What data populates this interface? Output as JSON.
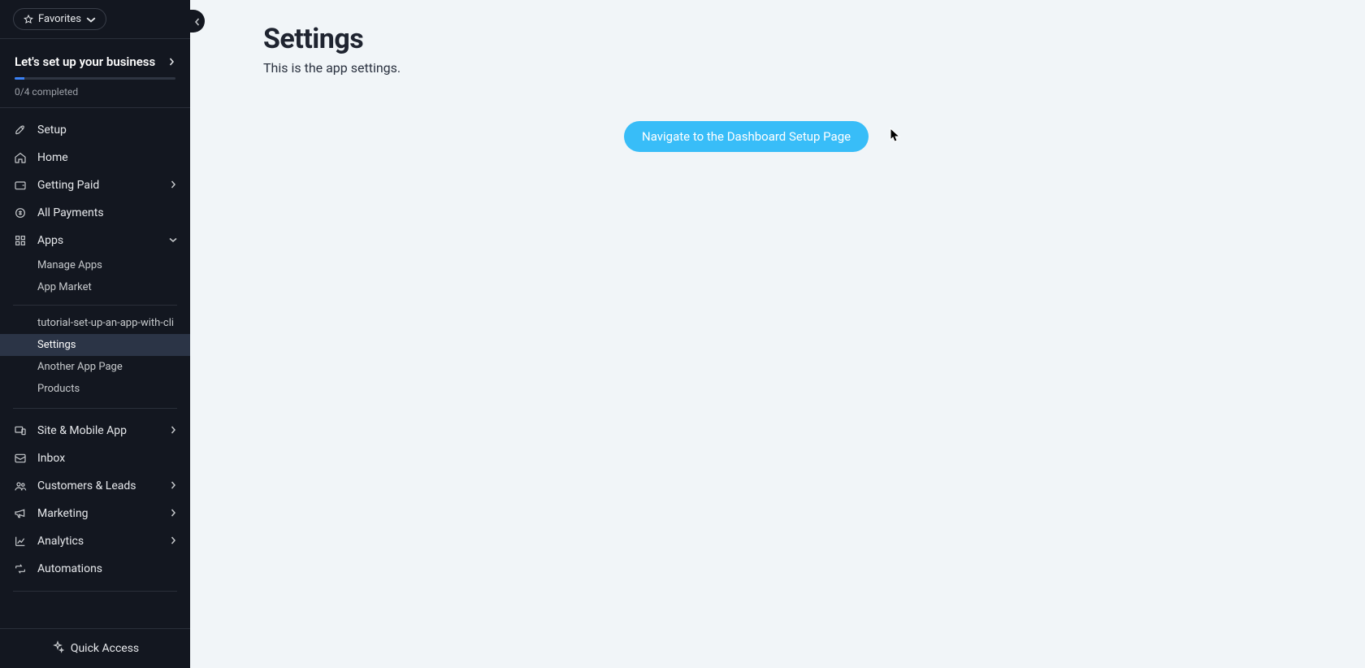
{
  "favorites": {
    "label": "Favorites"
  },
  "setup_block": {
    "title": "Let's set up your business",
    "progress_label": "0/4 completed"
  },
  "nav": {
    "setup": "Setup",
    "home": "Home",
    "getting_paid": "Getting Paid",
    "all_payments": "All Payments",
    "apps": "Apps",
    "apps_sub": {
      "manage_apps": "Manage Apps",
      "app_market": "App Market",
      "tutorial": "tutorial-set-up-an-app-with-cli",
      "settings": "Settings",
      "another_app_page": "Another App Page",
      "products": "Products"
    },
    "site_mobile": "Site & Mobile App",
    "inbox": "Inbox",
    "customers_leads": "Customers & Leads",
    "marketing": "Marketing",
    "analytics": "Analytics",
    "automations": "Automations"
  },
  "quick_access": {
    "label": "Quick Access"
  },
  "page": {
    "title": "Settings",
    "subtitle": "This is the app settings.",
    "navigate_button": "Navigate to the Dashboard Setup Page"
  }
}
